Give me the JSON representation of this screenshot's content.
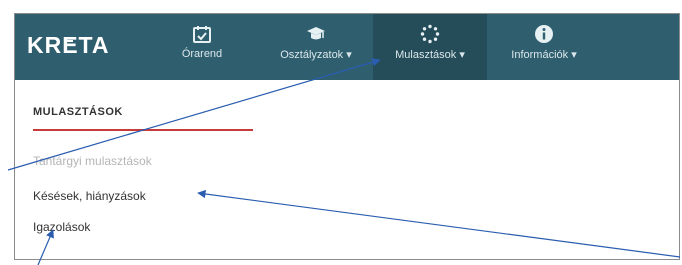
{
  "app": {
    "logo": "KRETA"
  },
  "nav": {
    "items": [
      {
        "label": "Órarend",
        "icon": "calendar-icon"
      },
      {
        "label": "Osztályzatok ▾",
        "icon": "graduation-cap-icon"
      },
      {
        "label": "Mulasztások ▾",
        "icon": "dotted-circle-icon"
      },
      {
        "label": "Információk ▾",
        "icon": "info-icon"
      }
    ]
  },
  "section": {
    "title": "MULASZTÁSOK",
    "links": [
      {
        "label": "Tantárgyi mulasztások",
        "state": "disabled"
      },
      {
        "label": "Késések, hiányzások",
        "state": "normal"
      },
      {
        "label": "Igazolások",
        "state": "normal"
      }
    ]
  },
  "colors": {
    "topbar": "#2f5f6f",
    "topbar_active": "#254c59",
    "accent_rule": "#c73b3b",
    "annotation_arrow": "#2a5db0"
  }
}
